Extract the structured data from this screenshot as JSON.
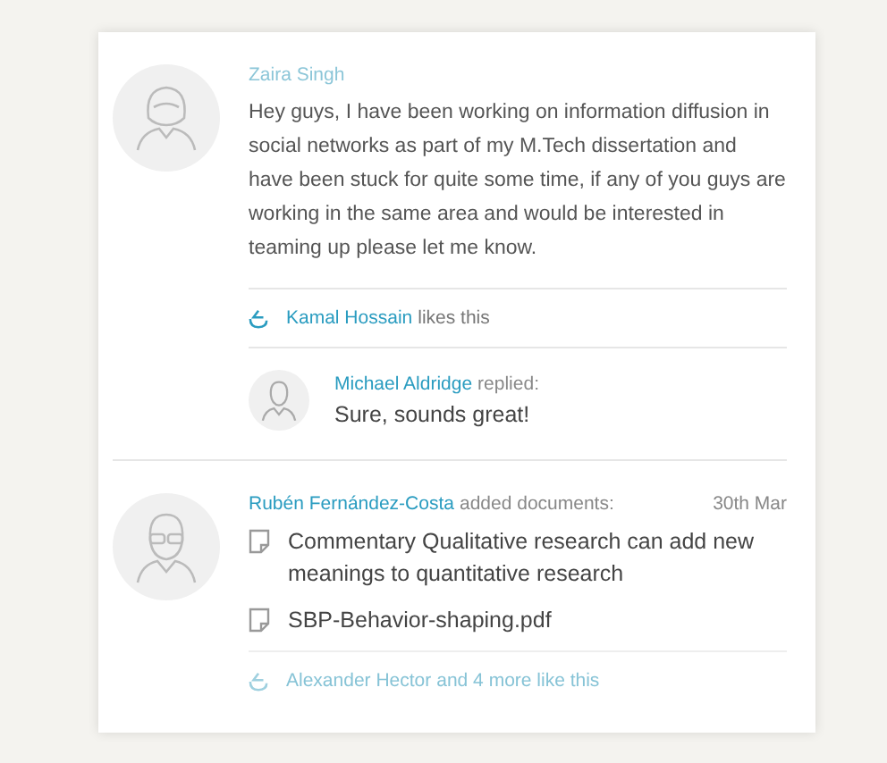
{
  "posts": [
    {
      "avatar": {
        "kind": "woman"
      },
      "author": "Zaira Singh",
      "body": "Hey guys, I have been working on information diffusion in social networks as part of my M.Tech dissertation and have been stuck for quite some time, if any of you guys are working in the same area and would be interested in teaming up please let me know.",
      "likes": {
        "names": "Kamal Hossain",
        "text": "likes this"
      },
      "replies": [
        {
          "avatar": {
            "kind": "man"
          },
          "author": "Michael Aldridge",
          "action": "replied:",
          "text": "Sure, sounds great!"
        }
      ]
    },
    {
      "avatar": {
        "kind": "man-glasses"
      },
      "author": "Rubén Fernández-Costa",
      "action": "added documents:",
      "date": "30th Mar",
      "documents": [
        "Commentary Qualitative research can add new meanings to quantitative research",
        "SBP-Behavior-shaping.pdf"
      ],
      "likes": {
        "names": "Alexander Hector",
        "text": "and 4 more like this"
      }
    }
  ]
}
